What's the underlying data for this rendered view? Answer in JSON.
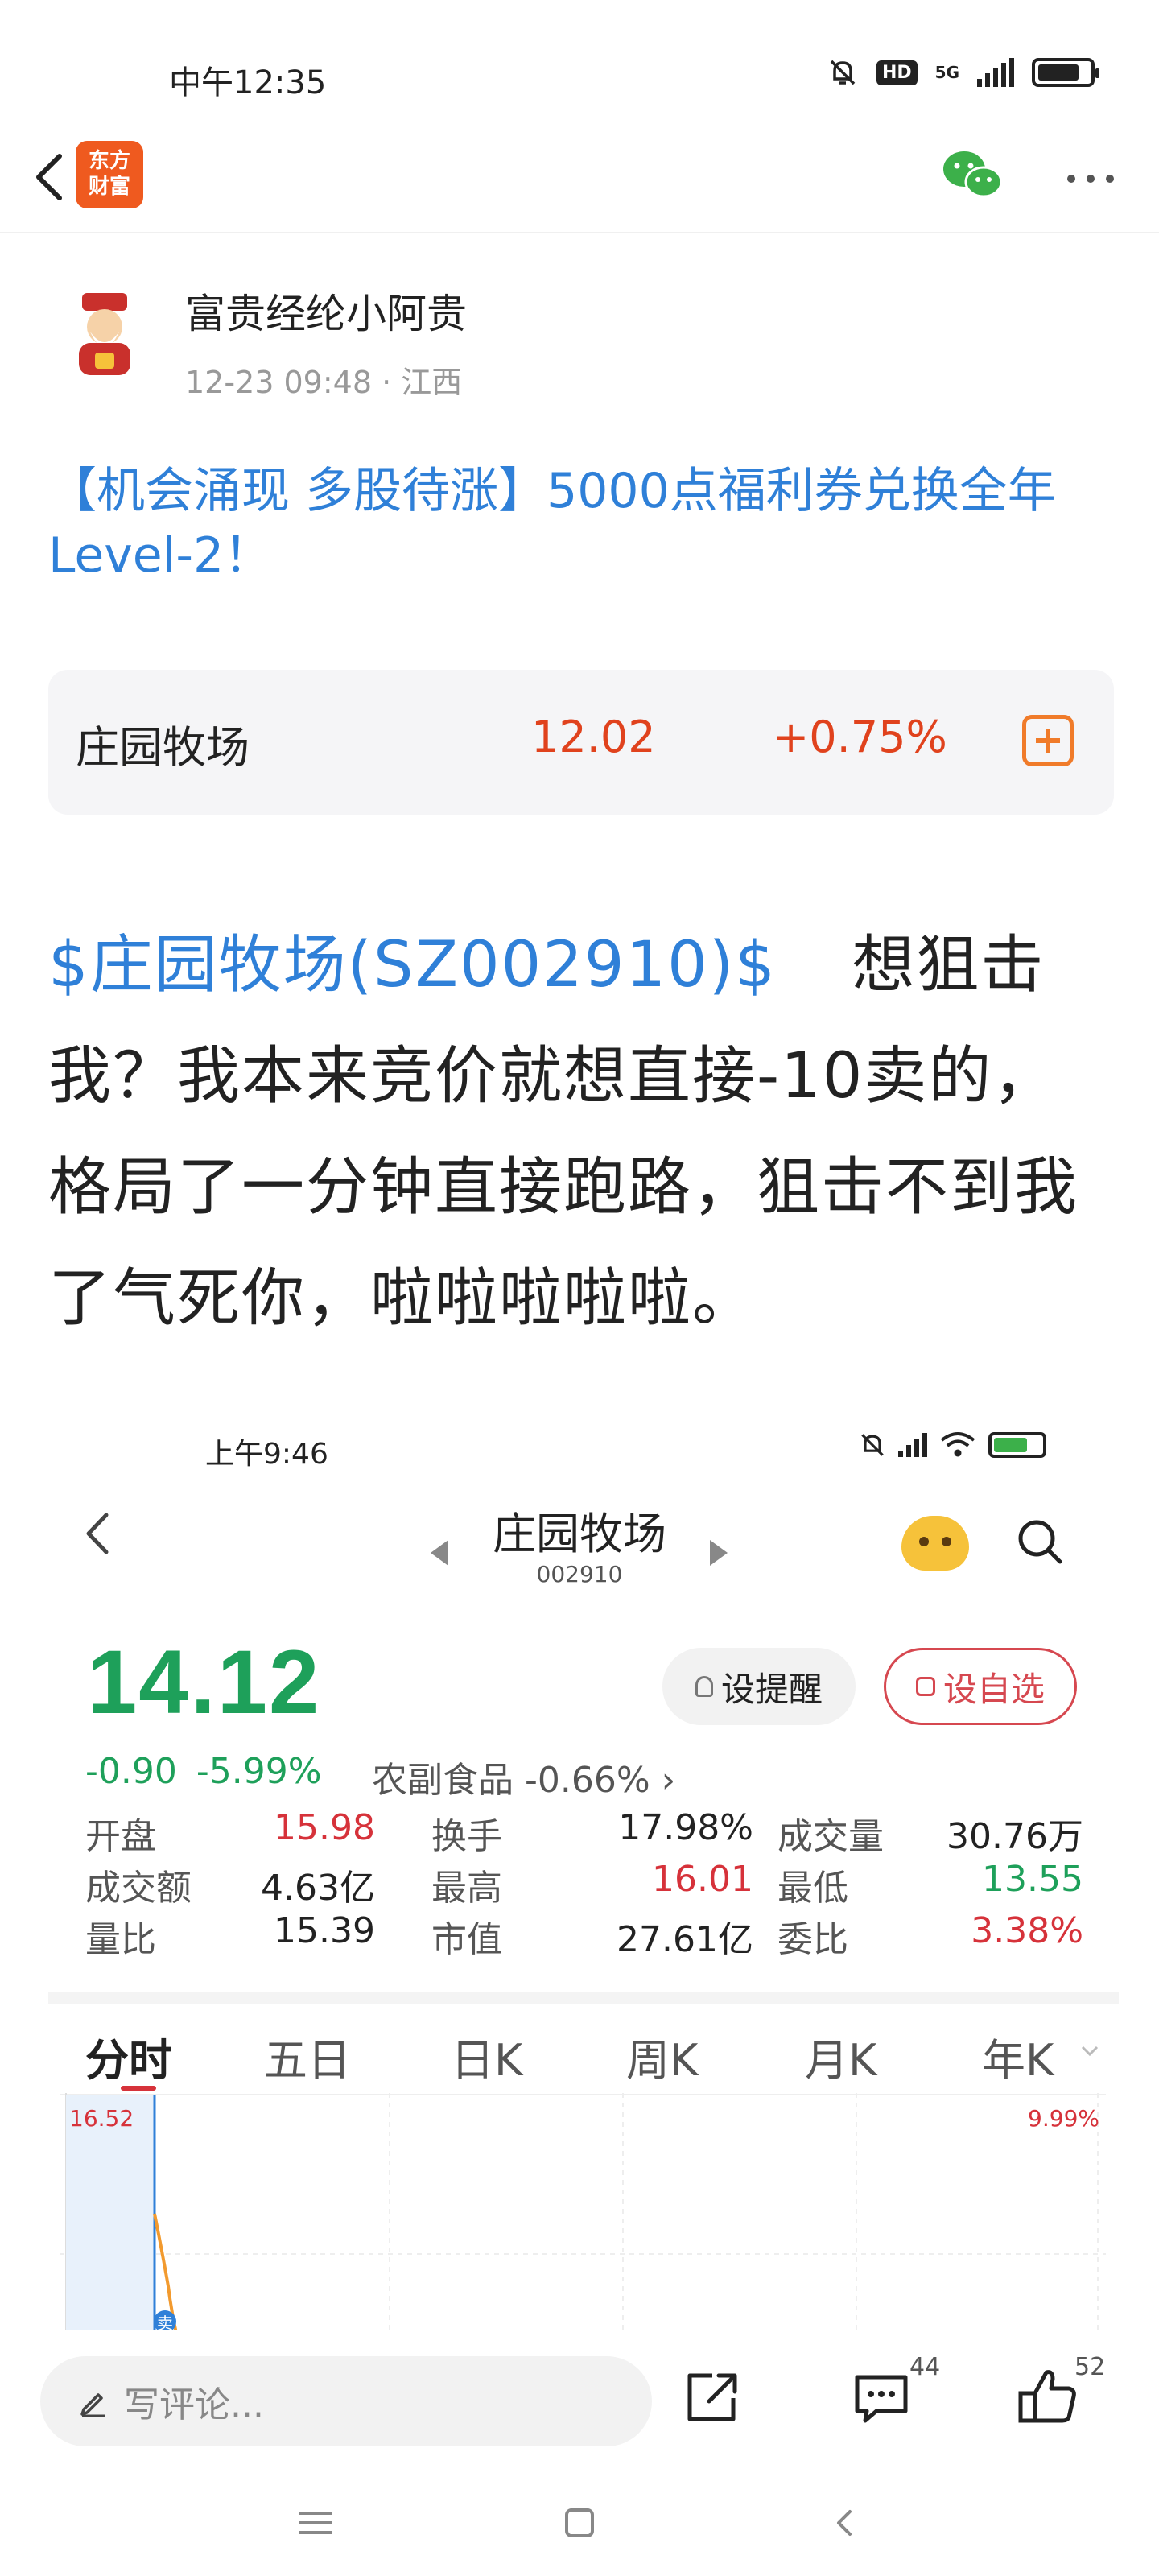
{
  "status_bar": {
    "time": "中午12:35",
    "network": "5G",
    "hd": "HD"
  },
  "nav": {
    "logo_text_line1": "东方",
    "logo_text_line2": "财富"
  },
  "author": {
    "name": "富贵经纶小阿贵",
    "date": "12-23 09:48",
    "location": "· 江西"
  },
  "post": {
    "title": "【机会涌现 多股待涨】5000点福利券兑换全年Level-2！",
    "stock_link": "$庄园牧场(SZ002910)$",
    "body_text": "想狙击我？我本来竞价就想直接-10卖的，格局了一分钟直接跑路，狙击不到我了气死你，啦啦啦啦啦。"
  },
  "stock_card": {
    "name": "庄园牧场",
    "price": "12.02",
    "change": "+0.75%"
  },
  "screenshot": {
    "time": "上午9:46",
    "stock_name": "庄园牧场",
    "stock_code": "002910",
    "price": "14.12",
    "change": "-0.90",
    "change_pct": "-5.99%",
    "sector": "农副食品 -0.66% ›",
    "alert_label": "设提醒",
    "watch_label": "设自选",
    "stats": [
      {
        "label": "开盘",
        "value": "15.98",
        "color": "red"
      },
      {
        "label": "换手",
        "value": "17.98%",
        "color": "black"
      },
      {
        "label": "成交量",
        "value": "30.76万",
        "color": "black"
      },
      {
        "label": "成交额",
        "value": "4.63亿",
        "color": "black"
      },
      {
        "label": "最高",
        "value": "16.01",
        "color": "red"
      },
      {
        "label": "最低",
        "value": "13.55",
        "color": "green"
      },
      {
        "label": "量比",
        "value": "15.39",
        "color": "black"
      },
      {
        "label": "市值",
        "value": "27.61亿",
        "color": "black"
      },
      {
        "label": "委比",
        "value": "3.38%",
        "color": "red"
      }
    ],
    "tabs": [
      "分时",
      "五日",
      "日K",
      "周K",
      "月K",
      "年K"
    ],
    "chart_high": "16.52",
    "chart_high_pct": "9.99%",
    "sell_marker": "卖"
  },
  "action_bar": {
    "comment_placeholder": "写评论...",
    "comment_count": "44",
    "like_count": "52"
  },
  "colors": {
    "link_blue": "#2f80d8",
    "up_red": "#e0421d",
    "down_green": "#1ea05a",
    "brand_orange": "#ef5a1f"
  }
}
